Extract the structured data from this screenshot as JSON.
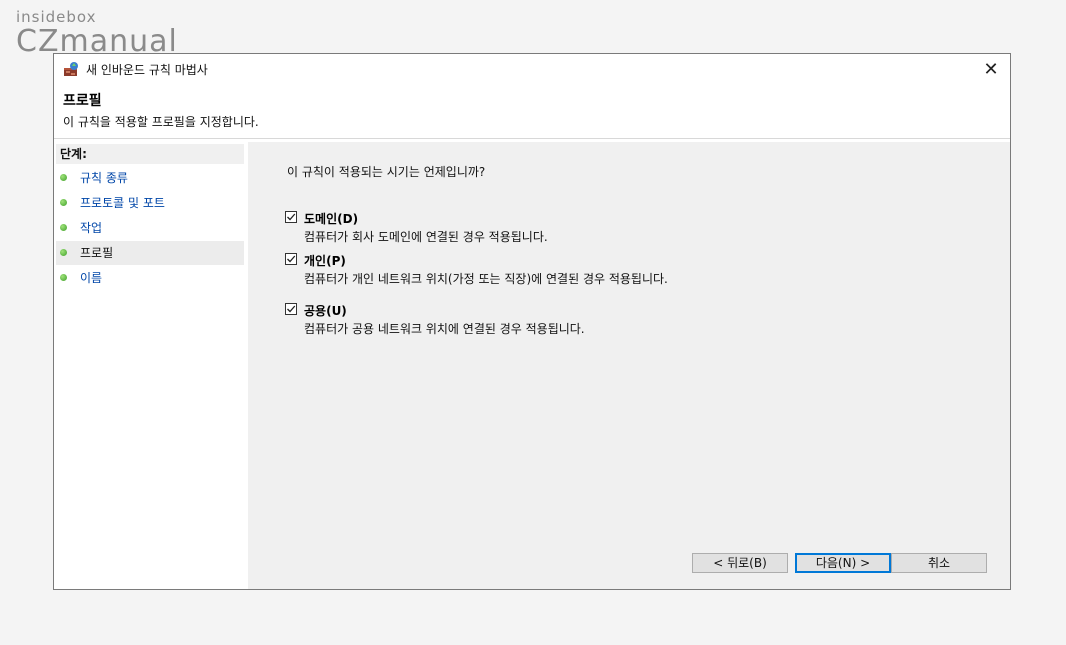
{
  "watermark": {
    "top": "insidebox",
    "bottom": "CZmanual"
  },
  "window": {
    "title": "새 인바운드 규칙 마법사",
    "close_symbol": "✕"
  },
  "header": {
    "title": "프로필",
    "subtitle": "이 규칙을 적용할 프로필을 지정합니다."
  },
  "steps": {
    "heading": "단계:",
    "items": [
      {
        "label": "규칙 종류"
      },
      {
        "label": "프로토콜 및 포트"
      },
      {
        "label": "작업"
      },
      {
        "label": "프로필"
      },
      {
        "label": "이름"
      }
    ]
  },
  "content": {
    "question": "이 규칙이 적용되는 시기는 언제입니까?",
    "options": [
      {
        "label": "도메인(D)",
        "description": "컴퓨터가 회사 도메인에 연결된 경우 적용됩니다."
      },
      {
        "label": "개인(P)",
        "description": "컴퓨터가 개인 네트워크 위치(가정 또는 직장)에 연결된 경우 적용됩니다."
      },
      {
        "label": "공용(U)",
        "description": "컴퓨터가 공용 네트워크 위치에 연결된 경우 적용됩니다."
      }
    ]
  },
  "buttons": {
    "back": "< 뒤로(B)",
    "next": "다음(N) >",
    "cancel": "취소"
  },
  "colors": {
    "link": "#0046a8",
    "accent": "#0078d7",
    "step_dot": "#3fa02a"
  },
  "icons": {
    "app": "firewall-wizard-icon",
    "close": "close-icon",
    "step": "green-dot-icon",
    "check": "checkmark-icon"
  }
}
